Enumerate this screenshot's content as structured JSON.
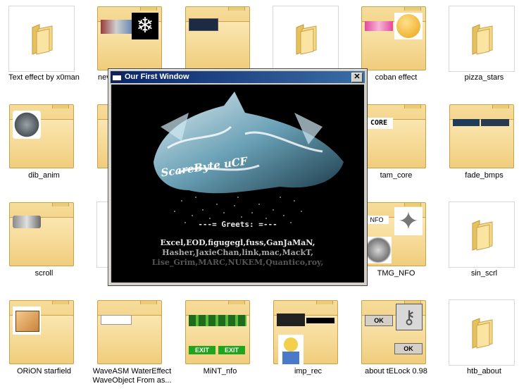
{
  "grid": {
    "items": [
      {
        "label": "Text effect by x0man"
      },
      {
        "label": "nev"
      },
      {
        "label": ""
      },
      {
        "label": ""
      },
      {
        "label": "coban effect"
      },
      {
        "label": "pizza_stars"
      },
      {
        "label": "dib_anim"
      },
      {
        "label": ""
      },
      {
        "label": ""
      },
      {
        "label": ""
      },
      {
        "label": "tam_core"
      },
      {
        "label": "fade_bmps"
      },
      {
        "label": "scroll"
      },
      {
        "label": ""
      },
      {
        "label": ""
      },
      {
        "label": ""
      },
      {
        "label": "TMG_NFO"
      },
      {
        "label": "sin_scrl"
      },
      {
        "label": "ORiON starfield"
      },
      {
        "label": "WaveASM  WaterEffect WaveObject From as..."
      },
      {
        "label": "MiNT_nfo"
      },
      {
        "label": "imp_rec"
      },
      {
        "label": "about tELock 0.98"
      },
      {
        "label": "htb_about"
      }
    ],
    "thumb_text": {
      "tam_core_logo": "CORE",
      "tmg_nfo_tag": "NFO",
      "mint_exit_1": "EXIT",
      "mint_exit_2": "EXIT",
      "telock_ok_1": "OK",
      "telock_ok_2": "OK"
    }
  },
  "window": {
    "title": "Our First Window",
    "close_glyph": "✕",
    "logo_text": "ScareByte uCF",
    "greets_title": "---= Greets: =---",
    "greets_lines": [
      "Excel,EOD,figugegl,fuss,GanJaMaN,",
      "Hasher,JaxieChan,link,mac,MackT,",
      "Lise_Grim,MARC,NUKEM,Quantico,roy,"
    ]
  },
  "colors": {
    "title_bar_start": "#0a246a",
    "title_bar_end": "#3a6ea5",
    "window_face": "#d4d0c8",
    "demo_background": "#000000",
    "folder_yellow": "#f0cd7c"
  }
}
